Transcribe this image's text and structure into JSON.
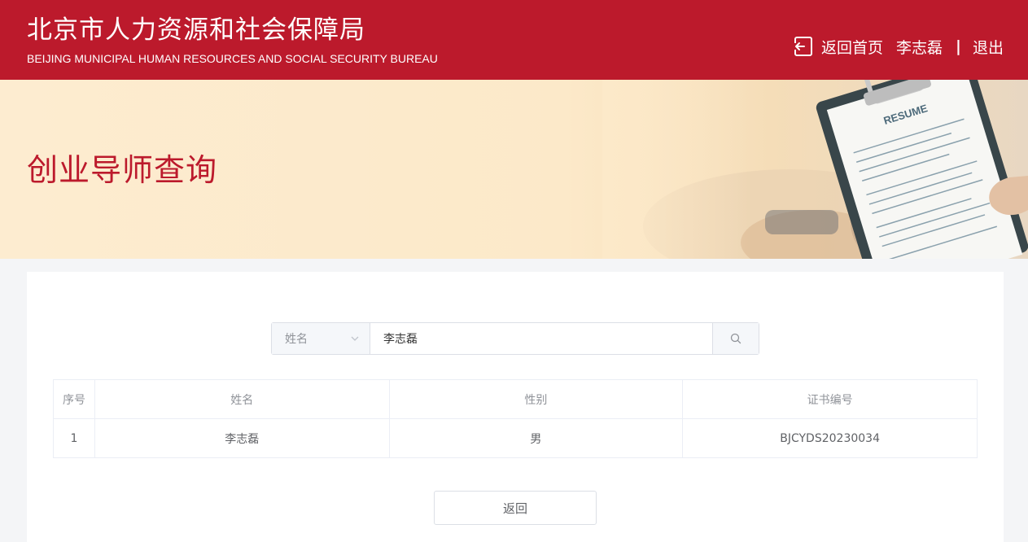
{
  "header": {
    "title_cn": "北京市人力资源和社会保障局",
    "title_en": "BEIJING MUNICIPAL HUMAN RESOURCES AND SOCIAL SECURITY BUREAU",
    "home_label": "返回首页",
    "user_name": "李志磊",
    "divider": "|",
    "logout_label": "退出",
    "bg_color": "#bc1a2c"
  },
  "banner": {
    "title": "创业导师查询"
  },
  "search": {
    "field_selected": "姓名",
    "value": "李志磊"
  },
  "table": {
    "columns": [
      "序号",
      "姓名",
      "性别",
      "证书编号"
    ],
    "rows": [
      [
        "1",
        "李志磊",
        "男",
        "BJCYDS20230034"
      ]
    ]
  },
  "actions": {
    "back_label": "返回"
  },
  "icons": {
    "home": "exit-return-icon",
    "select_arrow": "chevron-down-icon",
    "search": "search-icon"
  }
}
